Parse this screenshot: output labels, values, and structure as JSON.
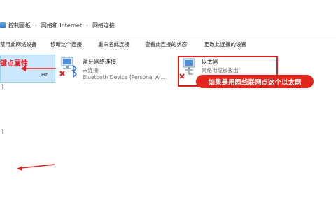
{
  "breadcrumb": {
    "items": [
      "控制面板",
      "网络和 Internet",
      "网络连接"
    ],
    "separator": "›"
  },
  "toolbar": {
    "disable_label": "禁用此网络设备",
    "diagnose_label": "诊断这个连接",
    "rename_label": "重命名此连接",
    "view_status_label": "查看此连接的状态",
    "change_settings_label": "更改此连接的设置"
  },
  "left_item": {
    "annotation_text": "键点属性",
    "partial_value": "Hz"
  },
  "connections": [
    {
      "name": "蓝牙网络连接",
      "status": "未连接",
      "device": "Bluetooth Device (Personal Ar..."
    },
    {
      "name": "以太网",
      "status": "网络电缆被拔出",
      "device": ""
    }
  ],
  "annotation": {
    "pill_text": "如果是用网线联网点这个以太网"
  },
  "left_edge_glyphs": {
    "paren": ")",
    "paren2": ")"
  },
  "colors": {
    "annotation_red": "#d9231c",
    "selection_bg": "#cce8ff",
    "selection_border": "#99d1ff"
  }
}
